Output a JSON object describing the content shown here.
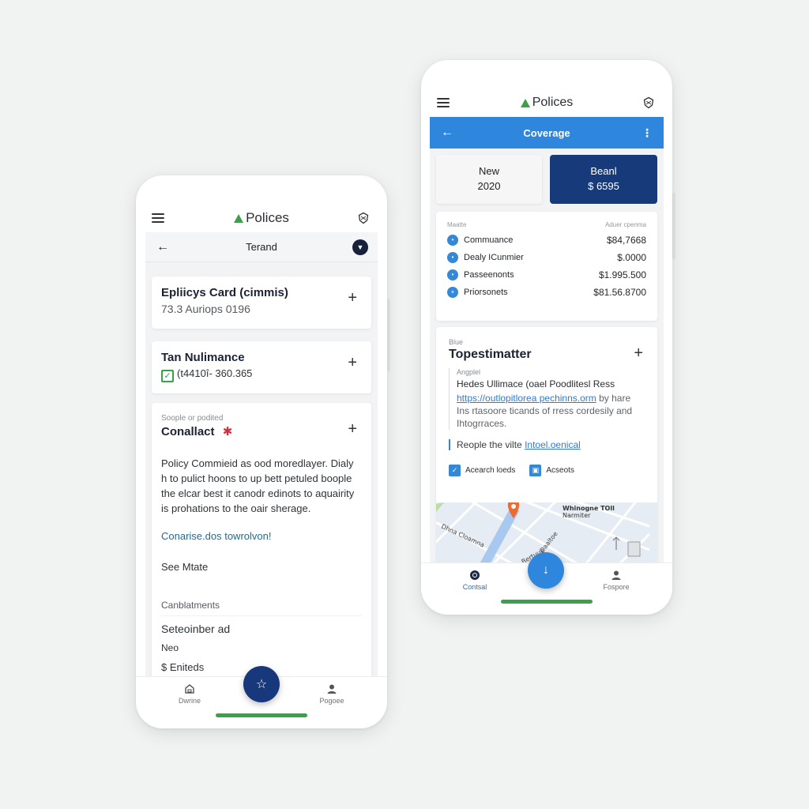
{
  "left_phone": {
    "app_title": "Polices",
    "subbar_title": "Terand",
    "cards": [
      {
        "title": "Epliicys Card (cimmis)",
        "subtitle": "73.3 Auriops 0196"
      },
      {
        "title": "Tan Nulimance",
        "subtitle": "(t4410î- 360.365"
      }
    ],
    "contact_card": {
      "label": "Soople or podited",
      "title": "Conallact",
      "paragraph": "Policy Commieid as ood moredlayer. Dialy h to pulict hoons to up bett petuled boople the elcar best it canodr edinots to aquairity is prohations to the oair sherage.",
      "link": "Conarise.dos towrolvon!",
      "see_more": "See Mtate",
      "list_header": "Canblatments",
      "list_items": [
        "Seteoinber ad",
        "Neo",
        "$ Eniteds"
      ]
    },
    "nav": {
      "left": "Dwrine",
      "right": "Pogoee"
    }
  },
  "right_phone": {
    "app_title": "Polices",
    "bar_title": "Coverage",
    "tiles": [
      {
        "line1": "New",
        "line2": "2020"
      },
      {
        "line1": "Beanl",
        "line2": "$ 6595"
      }
    ],
    "rows_header": {
      "left": "Maatte",
      "right": "Aduer cpenma"
    },
    "rows": [
      {
        "label": "Commuance",
        "value": "$84,7668"
      },
      {
        "label": "Dealy ICunmier",
        "value": "$.0000"
      },
      {
        "label": "Passeenonts",
        "value": "$1.995.500"
      },
      {
        "label": "Priorsonets",
        "value": "$81.56.8700"
      }
    ],
    "topest": {
      "label": "Blue",
      "title": "Topestimatter",
      "quote_label": "Angplel",
      "quote_title": "Hedes Ullimace (oael Poodlitesl Ress",
      "quote_link": "https://outlopitlorea pechinns.orm",
      "quote_link_tail": " by hare",
      "quote_rest": "Ins rtasoore ticands of rress cordesily and Ihtogrraces.",
      "people_text": "Reople the vilte ",
      "people_link": "Intoel.oenical",
      "chips": [
        "Acearch loeds",
        "Acseots"
      ]
    },
    "map": {
      "label_line1": "Whinogne TOll",
      "label_line2": "Narmiter",
      "street1": "Dhna Cloamna",
      "street2": "Daaltoe",
      "street3": "Bertuue"
    },
    "nav": {
      "left": "Contsal",
      "right": "Fospore"
    }
  }
}
